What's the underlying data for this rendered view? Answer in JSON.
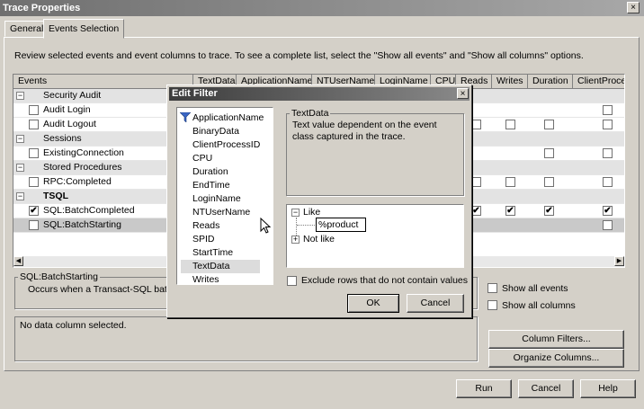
{
  "window": {
    "title": "Trace Properties",
    "close_glyph": "×"
  },
  "tabs": [
    {
      "label": "General"
    },
    {
      "label": "Events Selection"
    }
  ],
  "instructions": "Review selected events and event columns to trace. To see a complete list, select the \"Show all events\" and \"Show all columns\" options.",
  "grid": {
    "columns": [
      "Events",
      "TextData",
      "ApplicationName",
      "NTUserName",
      "LoginName",
      "CPU",
      "Reads",
      "Writes",
      "Duration",
      "ClientProcess"
    ],
    "rows": [
      {
        "label": "Security Audit",
        "type": "category",
        "expander": "−"
      },
      {
        "label": "Audit Login",
        "type": "event"
      },
      {
        "label": "Audit Logout",
        "type": "event"
      },
      {
        "label": "Sessions",
        "type": "category",
        "expander": "−"
      },
      {
        "label": "ExistingConnection",
        "type": "event"
      },
      {
        "label": "Stored Procedures",
        "type": "category",
        "expander": "−"
      },
      {
        "label": "RPC:Completed",
        "type": "event"
      },
      {
        "label": "TSQL",
        "type": "category",
        "expander": "−"
      },
      {
        "label": "SQL:BatchCompleted",
        "type": "event",
        "check": "✔"
      },
      {
        "label": "SQL:BatchStarting",
        "type": "event"
      }
    ]
  },
  "event_description": {
    "title": "SQL:BatchStarting",
    "text": "Occurs when a Transact-SQL batch is"
  },
  "column_description": {
    "text": "No data column selected."
  },
  "options": {
    "show_all_events": "Show all events",
    "show_all_columns": "Show all columns"
  },
  "buttons": {
    "column_filters": "Column Filters...",
    "organize_columns": "Organize Columns...",
    "run": "Run",
    "cancel": "Cancel",
    "help": "Help"
  },
  "edit_filter": {
    "title": "Edit Filter",
    "close_glyph": "×",
    "columns": [
      "ApplicationName",
      "BinaryData",
      "ClientProcessID",
      "CPU",
      "Duration",
      "EndTime",
      "LoginName",
      "NTUserName",
      "Reads",
      "SPID",
      "StartTime",
      "TextData",
      "Writes"
    ],
    "selected_column": "TextData",
    "description_title": "TextData",
    "description_text": "Text value dependent on the event class captured in the trace.",
    "tree": {
      "like_label": "Like",
      "like_expander": "−",
      "like_value": "%product",
      "not_like_label": "Not like",
      "not_like_expander": "+"
    },
    "exclude_label": "Exclude rows that do not contain values",
    "ok_label": "OK",
    "cancel_label": "Cancel"
  },
  "icons": {
    "filter": "filter-icon",
    "scroll_left": "◀",
    "scroll_right": "▶",
    "cursor": "mouse-cursor-icon"
  }
}
